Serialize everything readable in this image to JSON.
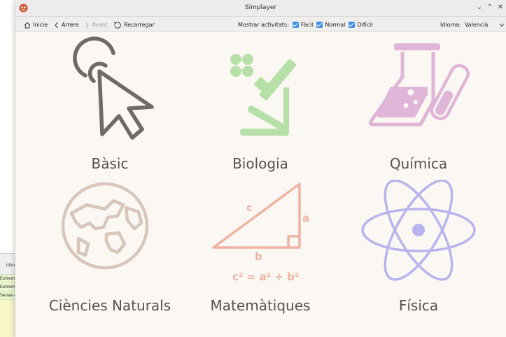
{
  "background_window": {
    "header": "Idioma",
    "rows": [
      "Extrem fàcil",
      "Extrem fàcil",
      "Sense exercicis"
    ]
  },
  "window": {
    "title": "Simplayer",
    "controls": {
      "minimize": "⌄",
      "maximize": "⌃",
      "close": "✕"
    }
  },
  "toolbar": {
    "home_label": "Inicie",
    "back_label": "Arrere",
    "forward_label": "Avant",
    "reload_label": "Recarregar",
    "show_label": "Mostrar activitats:",
    "filters": [
      {
        "label": "Fàcil",
        "checked": true
      },
      {
        "label": "Normal",
        "checked": true
      },
      {
        "label": "Difícil",
        "checked": true
      }
    ],
    "language_label": "Idioma:",
    "language_value": "Valencià"
  },
  "subjects": [
    {
      "label": "Bàsic",
      "icon": "cursor-click-icon",
      "color": "#6e6a66"
    },
    {
      "label": "Biologia",
      "icon": "microscope-icon",
      "color": "#b6e0a7"
    },
    {
      "label": "Química",
      "icon": "flask-icon",
      "color": "#e0b6d8"
    },
    {
      "label": "Ciències Naturals",
      "icon": "globe-icon",
      "color": "#d8c6bb"
    },
    {
      "label": "Matemàtiques",
      "icon": "triangle-icon",
      "color": "#f0b3a3"
    },
    {
      "label": "Física",
      "icon": "atom-icon",
      "color": "#b8b4ee"
    }
  ],
  "math_icon": {
    "side_a": "a",
    "side_b": "b",
    "side_c": "c",
    "formula": "c² = a² + b²"
  }
}
